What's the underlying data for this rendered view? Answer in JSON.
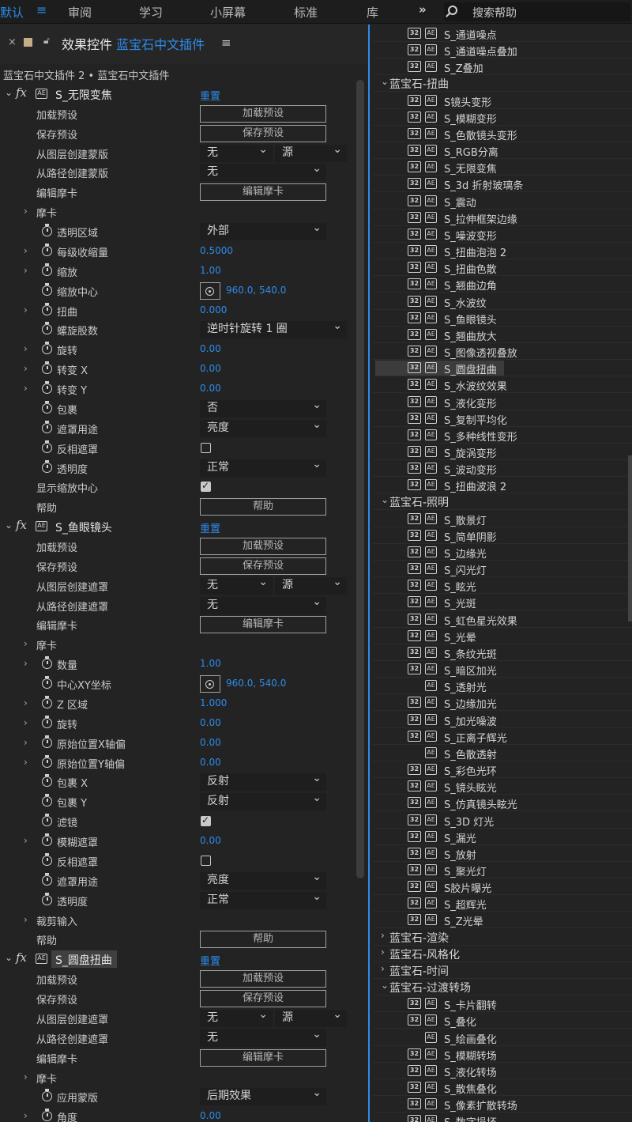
{
  "topbar": {
    "workspaces": [
      {
        "label": "默认",
        "active": true
      },
      {
        "label": "审阅",
        "active": false
      },
      {
        "label": "学习",
        "active": false
      },
      {
        "label": "小屏幕",
        "active": false
      },
      {
        "label": "标准",
        "active": false
      },
      {
        "label": "库",
        "active": false
      }
    ],
    "menu_icon": "hamburger-icon",
    "more_icon": "double-chevron-right-icon",
    "search_placeholder": "搜索帮助"
  },
  "effect_controls": {
    "close": "×",
    "lock_icon": "lock-icon",
    "title_prefix": "效果控件",
    "title_target": "蓝宝石中文插件",
    "menu": "≡",
    "subtitle": "蓝宝石中文插件 2 • 蓝宝石中文插件",
    "rows": [
      {
        "type": "fx",
        "name": "S_无限变焦",
        "reset": "重置"
      },
      {
        "type": "button",
        "label": "加载预设",
        "button": "加载预设"
      },
      {
        "type": "button",
        "label": "保存预设",
        "button": "保存预设"
      },
      {
        "type": "dual",
        "label": "从图层创建蒙版",
        "a": "无",
        "b": "源"
      },
      {
        "type": "dropdown",
        "label": "从路径创建蒙版",
        "value": "无",
        "w": "s"
      },
      {
        "type": "button",
        "label": "编辑摩卡",
        "button": "编辑摩卡"
      },
      {
        "type": "group",
        "label": "摩卡"
      },
      {
        "type": "dropdown",
        "label": "透明区域",
        "value": "外部",
        "w": "s",
        "sw": true
      },
      {
        "type": "value",
        "label": "每级收缩量",
        "value": "0.5000",
        "sw": true,
        "arrow": true
      },
      {
        "type": "value",
        "label": "缩放",
        "value": "1.00",
        "sw": true,
        "arrow": true
      },
      {
        "type": "point",
        "label": "缩放中心",
        "value": "960.0, 540.0",
        "sw": true
      },
      {
        "type": "value",
        "label": "扭曲",
        "value": "0.000",
        "sw": true,
        "arrow": true
      },
      {
        "type": "dropdown",
        "label": "螺旋股数",
        "value": "逆时针旋转 1 圈",
        "w": "l",
        "sw": true
      },
      {
        "type": "value",
        "label": "旋转",
        "value": "0.00",
        "sw": true,
        "arrow": true
      },
      {
        "type": "value",
        "label": "转变 X",
        "value": "0.00",
        "sw": true,
        "arrow": true
      },
      {
        "type": "value",
        "label": "转变 Y",
        "value": "0.00",
        "sw": true,
        "arrow": true
      },
      {
        "type": "dropdown",
        "label": "包裹",
        "value": "否",
        "w": "s",
        "sw": true
      },
      {
        "type": "dropdown",
        "label": "遮罩用途",
        "value": "亮度",
        "w": "s",
        "sw": true
      },
      {
        "type": "checkbox",
        "label": "反相遮罩",
        "checked": false,
        "sw": true
      },
      {
        "type": "dropdown",
        "label": "透明度",
        "value": "正常",
        "w": "s",
        "sw": true
      },
      {
        "type": "checkbox",
        "label": "显示缩放中心",
        "checked": true
      },
      {
        "type": "button",
        "label": "帮助",
        "button": "帮助"
      },
      {
        "type": "fx",
        "name": "S_鱼眼镜头",
        "reset": "重置"
      },
      {
        "type": "button",
        "label": "加载预设",
        "button": "加载预设"
      },
      {
        "type": "button",
        "label": "保存预设",
        "button": "保存预设"
      },
      {
        "type": "dual",
        "label": "从图层创建遮罩",
        "a": "无",
        "b": "源"
      },
      {
        "type": "dropdown",
        "label": "从路径创建遮罩",
        "value": "无",
        "w": "s"
      },
      {
        "type": "button",
        "label": "编辑摩卡",
        "button": "编辑摩卡"
      },
      {
        "type": "group",
        "label": "摩卡"
      },
      {
        "type": "value",
        "label": "数量",
        "value": "1.00",
        "sw": true,
        "arrow": true
      },
      {
        "type": "point",
        "label": "中心XY坐标",
        "value": "960.0, 540.0",
        "sw": true
      },
      {
        "type": "value",
        "label": "Z 区域",
        "value": "1.000",
        "sw": true,
        "arrow": true
      },
      {
        "type": "value",
        "label": "旋转",
        "value": "0.00",
        "sw": true,
        "arrow": true
      },
      {
        "type": "value",
        "label": "原始位置X轴偏",
        "value": "0.00",
        "sw": true,
        "arrow": true
      },
      {
        "type": "value",
        "label": "原始位置Y轴偏",
        "value": "0.00",
        "sw": true,
        "arrow": true
      },
      {
        "type": "dropdown",
        "label": "包裹 X",
        "value": "反射",
        "w": "s",
        "sw": true
      },
      {
        "type": "dropdown",
        "label": "包裹 Y",
        "value": "反射",
        "w": "s",
        "sw": true
      },
      {
        "type": "checkbox",
        "label": "滤镜",
        "checked": true,
        "sw": true
      },
      {
        "type": "value",
        "label": "模糊遮罩",
        "value": "0.00",
        "sw": true,
        "arrow": true
      },
      {
        "type": "checkbox",
        "label": "反相遮罩",
        "checked": false,
        "sw": true
      },
      {
        "type": "dropdown",
        "label": "遮罩用途",
        "value": "亮度",
        "w": "s",
        "sw": true
      },
      {
        "type": "dropdown",
        "label": "透明度",
        "value": "正常",
        "w": "s",
        "sw": true
      },
      {
        "type": "group",
        "label": "裁剪输入"
      },
      {
        "type": "button",
        "label": "帮助",
        "button": "帮助"
      },
      {
        "type": "fx",
        "name": "S_圆盘扭曲",
        "reset": "重置",
        "selected": true
      },
      {
        "type": "button",
        "label": "加载预设",
        "button": "加载预设"
      },
      {
        "type": "button",
        "label": "保存预设",
        "button": "保存预设"
      },
      {
        "type": "dual",
        "label": "从图层创建遮罩",
        "a": "无",
        "b": "源"
      },
      {
        "type": "dropdown",
        "label": "从路径创建遮罩",
        "value": "无",
        "w": "s"
      },
      {
        "type": "button",
        "label": "编辑摩卡",
        "button": "编辑摩卡"
      },
      {
        "type": "group",
        "label": "摩卡"
      },
      {
        "type": "dropdown",
        "label": "应用蒙版",
        "value": "后期效果",
        "w": "s",
        "sw": true
      },
      {
        "type": "value",
        "label": "角度",
        "value": "0.00",
        "sw": true,
        "arrow": true
      }
    ]
  },
  "effects_list": {
    "badge_32": "32",
    "rows": [
      {
        "t": "i",
        "label": "S_通道噪点"
      },
      {
        "t": "i",
        "label": "S_通道噪点叠加"
      },
      {
        "t": "i",
        "label": "S_Z叠加"
      },
      {
        "t": "g",
        "label": "蓝宝石-扭曲",
        "open": true
      },
      {
        "t": "i",
        "label": "S镜头变形"
      },
      {
        "t": "i",
        "label": "S_模糊变形"
      },
      {
        "t": "i",
        "label": "S_色散镜头变形"
      },
      {
        "t": "i",
        "label": "S_RGB分离"
      },
      {
        "t": "i",
        "label": "S_无限变焦"
      },
      {
        "t": "i",
        "label": "S_3d 折射玻璃条"
      },
      {
        "t": "i",
        "label": "S_震动"
      },
      {
        "t": "i",
        "label": "S_拉伸框架边缘"
      },
      {
        "t": "i",
        "label": "S_噪波变形"
      },
      {
        "t": "i",
        "label": "S_扭曲泡泡 2"
      },
      {
        "t": "i",
        "label": "S_扭曲色散"
      },
      {
        "t": "i",
        "label": "S_翘曲边角"
      },
      {
        "t": "i",
        "label": "S_水波纹"
      },
      {
        "t": "i",
        "label": "S_鱼眼镜头"
      },
      {
        "t": "i",
        "label": "S_翘曲放大"
      },
      {
        "t": "i",
        "label": "S_图像透视叠放"
      },
      {
        "t": "i",
        "label": "S_圆盘扭曲",
        "selected": true
      },
      {
        "t": "i",
        "label": "S_水波纹效果"
      },
      {
        "t": "i",
        "label": "S_液化变形"
      },
      {
        "t": "i",
        "label": "S_复制平均化"
      },
      {
        "t": "i",
        "label": "S_多种线性变形"
      },
      {
        "t": "i",
        "label": "S_旋涡变形"
      },
      {
        "t": "i",
        "label": "S_波动变形"
      },
      {
        "t": "i",
        "label": "S_扭曲波浪 2"
      },
      {
        "t": "g",
        "label": "蓝宝石-照明",
        "open": true
      },
      {
        "t": "i",
        "label": "S_散景灯"
      },
      {
        "t": "i",
        "label": "S_简单阴影"
      },
      {
        "t": "i",
        "label": "S_边缘光"
      },
      {
        "t": "i",
        "label": "S_闪光灯"
      },
      {
        "t": "i",
        "label": "S_眩光"
      },
      {
        "t": "i",
        "label": "S_光斑"
      },
      {
        "t": "i",
        "label": "S_虹色星光效果"
      },
      {
        "t": "i",
        "label": "S_光晕"
      },
      {
        "t": "i",
        "label": "S_条纹光斑"
      },
      {
        "t": "i",
        "label": "S_暗区加光"
      },
      {
        "t": "i",
        "label": "S_透射光",
        "no32": true
      },
      {
        "t": "i",
        "label": "S_边缘加光"
      },
      {
        "t": "i",
        "label": "S_加光噪波"
      },
      {
        "t": "i",
        "label": "S_正离子辉光"
      },
      {
        "t": "i",
        "label": "S_色散透射",
        "no32": true
      },
      {
        "t": "i",
        "label": "S_彩色光环"
      },
      {
        "t": "i",
        "label": "S_镜头眩光"
      },
      {
        "t": "i",
        "label": "S_仿真镜头眩光"
      },
      {
        "t": "i",
        "label": "S_3D 灯光"
      },
      {
        "t": "i",
        "label": "S_漏光"
      },
      {
        "t": "i",
        "label": "S_放射"
      },
      {
        "t": "i",
        "label": "S_聚光灯"
      },
      {
        "t": "i",
        "label": "S胶片曝光"
      },
      {
        "t": "i",
        "label": "S_超辉光"
      },
      {
        "t": "i",
        "label": "S_Z光晕"
      },
      {
        "t": "g",
        "label": "蓝宝石-渲染",
        "open": false
      },
      {
        "t": "g",
        "label": "蓝宝石-风格化",
        "open": false
      },
      {
        "t": "g",
        "label": "蓝宝石-时间",
        "open": false
      },
      {
        "t": "g",
        "label": "蓝宝石-过渡转场",
        "open": true
      },
      {
        "t": "i",
        "label": "S_卡片翻转"
      },
      {
        "t": "i",
        "label": "S_叠化"
      },
      {
        "t": "i",
        "label": "S_绘画叠化",
        "no32": true
      },
      {
        "t": "i",
        "label": "S_模糊转场"
      },
      {
        "t": "i",
        "label": "S_液化转场"
      },
      {
        "t": "i",
        "label": "S_散焦叠化"
      },
      {
        "t": "i",
        "label": "S_像素扩散转场"
      },
      {
        "t": "i",
        "label": "S_数字损坏"
      }
    ]
  },
  "colors": {
    "accent": "#2d8ceb",
    "panel_bg": "#232323",
    "topbar_bg": "#1d1d1d"
  }
}
